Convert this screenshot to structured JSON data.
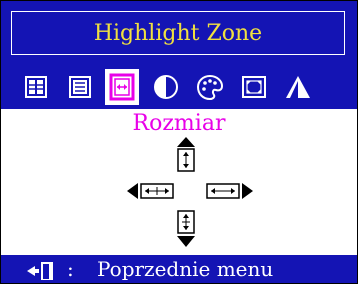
{
  "title": "Highlight Zone",
  "subtitle": "Rozmiar",
  "menu_icons": [
    {
      "name": "display-grid-icon",
      "selected": false
    },
    {
      "name": "document-list-icon",
      "selected": false
    },
    {
      "name": "size-adjust-icon",
      "selected": true
    },
    {
      "name": "contrast-icon",
      "selected": false
    },
    {
      "name": "color-palette-icon",
      "selected": false
    },
    {
      "name": "expand-screen-icon",
      "selected": false
    },
    {
      "name": "sharpness-triangle-icon",
      "selected": false
    }
  ],
  "footer": {
    "icon": "exit-door-icon",
    "separator": ":",
    "label": "Poprzednie menu"
  },
  "colors": {
    "background": "#1414b4",
    "title": "#f0e040",
    "subtitle": "#e800e8",
    "selected_tab": "#ffffff"
  }
}
